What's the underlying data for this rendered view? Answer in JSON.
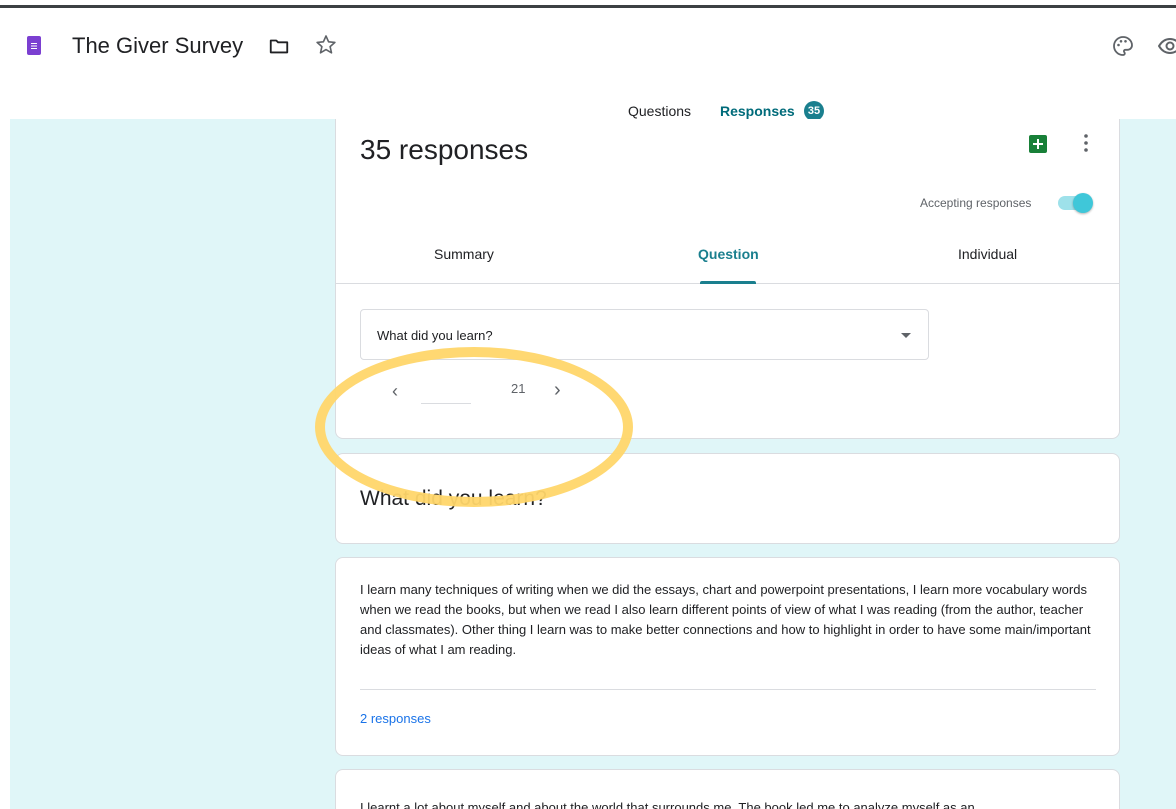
{
  "header": {
    "doc_title": "The Giver Survey",
    "icons": [
      "forms-icon",
      "folder-icon",
      "star-icon",
      "palette-icon",
      "eye-icon"
    ]
  },
  "top_tabs": {
    "questions_label": "Questions",
    "responses_label": "Responses",
    "responses_badge": "35"
  },
  "summary_card": {
    "count_title": "35 responses",
    "accepting_label": "Accepting responses",
    "accepting_on": true,
    "sub_tabs": {
      "summary": "Summary",
      "question": "Question",
      "individual": "Individual"
    },
    "selected_question": "What did you learn?",
    "pager": {
      "total": "21"
    }
  },
  "question_card": {
    "title": "What did you learn?"
  },
  "answers": [
    {
      "text": "I learn many techniques of writing when we did the essays, chart and powerpoint presentations, I learn more vocabulary words when we read the books, but when we read I also learn different points of view of what I was reading (from the author, teacher and classmates). Other thing I learn was to make better connections and how to highlight in order to have some main/important ideas of what I am reading.",
      "count_label": "2 responses"
    },
    {
      "text": "I learnt a lot about myself and about the world that surrounds me. The book led me to analyze myself as an"
    }
  ],
  "colors": {
    "accent": "#1a7f8e",
    "background": "#e0f6f8",
    "forms_purple": "#7b3fd1",
    "highlight": "#ffd66a",
    "link": "#1a73e8"
  }
}
